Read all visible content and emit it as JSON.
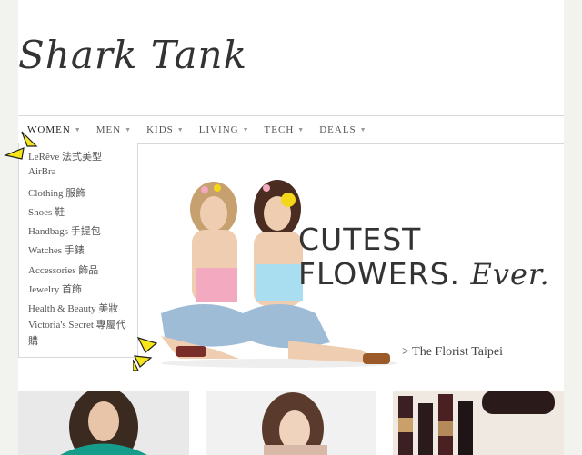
{
  "logo": "Shark Tank",
  "nav": [
    {
      "label": "WOMEN"
    },
    {
      "label": "MEN"
    },
    {
      "label": "KIDS"
    },
    {
      "label": "LIVING"
    },
    {
      "label": "TECH"
    },
    {
      "label": "DEALS"
    }
  ],
  "dropdown": [
    "LeRêve 法式美型",
    "AirBra",
    "Clothing 服飾",
    "Shoes 鞋",
    "Handbags 手提包",
    "Watches 手錶",
    "Accessories 飾品",
    "Jewelry 首飾",
    "Health & Beauty 美妝",
    "Victoria's Secret 專屬代購"
  ],
  "hero": {
    "line1": "CUTEST",
    "line2": "FLOWERS.",
    "ever": "Ever.",
    "florist": "> The Florist Taipei"
  },
  "colors": {
    "background": "#f2f2ef",
    "panel": "#ffffff",
    "border": "#d8d8d8",
    "accent_arrow": "#f5e51a"
  },
  "icons": [
    "chevron-down-icon",
    "arrow-pointer-icon"
  ]
}
